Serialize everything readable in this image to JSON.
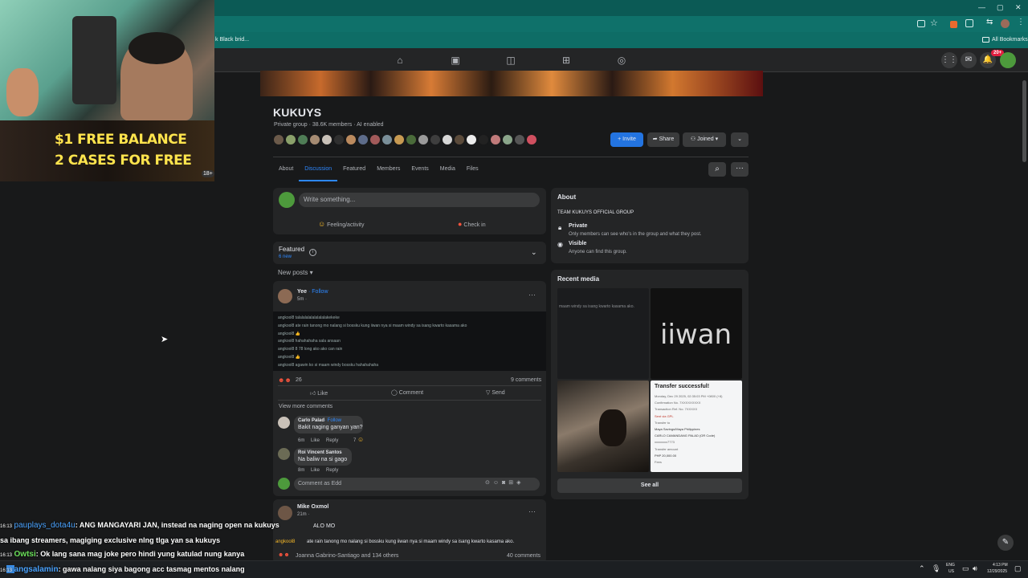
{
  "browser": {
    "bookmark_fragment": "k Black brid...",
    "all_bookmarks": "All Bookmarks",
    "window_controls": [
      "—",
      "▢",
      "✕"
    ]
  },
  "fbnav": {
    "notification_badge": "20+"
  },
  "group": {
    "name": "KUKUYS",
    "meta": "Private group · 38.6K members · AI enabled",
    "invite_label": "Invite",
    "share_label": "Share",
    "joined_label": "Joined",
    "tabs": [
      "About",
      "Discussion",
      "Featured",
      "Members",
      "Events",
      "Media",
      "Files"
    ],
    "active_tab": "Discussion"
  },
  "composer": {
    "placeholder": "Write something...",
    "feeling_label": "Feeling/activity",
    "checkin_label": "Check in"
  },
  "featured": {
    "title": "Featured",
    "subtitle": "6 new"
  },
  "feed": {
    "sort_label": "New posts",
    "post1": {
      "author": "Yee",
      "follow": "· Follow",
      "time": "5m ·",
      "reaction_count": "26",
      "comment_count": "9 comments",
      "like": "Like",
      "comment": "Comment",
      "send": "Send",
      "view_more": "View more comments",
      "embedded_lines": [
        "angkool8  talalalalalalalalalakekeke",
        "angkool8  ate rain tanong mo nalang si bossku kung iiwan nya si maam windy sa isang kwarto kasama ako",
        "angkool8  👍",
        "angkool8  hahahahaha sala ansaan",
        "angkool8  8 78 long ako ako can rain",
        "angkool8  👍",
        "angkool8  agawin ko si maam windy bossku hahahahaha"
      ],
      "comments": [
        {
          "author": "Carlo Palad",
          "follow": "· Follow",
          "text": "Bakit naging ganyan yan?",
          "time": "6m",
          "like": "Like",
          "reply": "Reply",
          "reactions": "7"
        },
        {
          "author": "Roi Vincent Santos",
          "follow": "",
          "text": "Na baliw na si gago",
          "time": "8m",
          "like": "Like",
          "reply": "Reply",
          "reactions": ""
        }
      ],
      "comment_placeholder": "Comment as Edd"
    },
    "post2": {
      "author": "Mike Oxmol",
      "time": "21m ·",
      "text_fragment": "ALO MO",
      "quote_user": "angkool8",
      "quote_text": "ate rain tanong mo nalang si bossku kung iiwan nya si maam windy sa isang kwarto kasama ako.",
      "reactors": "Joanna Gabrino-Santiago and 134 others",
      "comment_count": "40 comments"
    }
  },
  "about": {
    "title": "About",
    "description": "TEAM KUKUYS OFFICIAL GROUP",
    "private_title": "Private",
    "private_desc": "Only members can see who's in the group and what they post.",
    "visible_title": "Visible",
    "visible_desc": "Anyone can find this group."
  },
  "recent_media": {
    "title": "Recent media",
    "tile1_text": "maam windy sa isang kwarto kasama ako.",
    "tile2_text": "iiwan",
    "tile4_title": "Transfer successful!",
    "tile4_lines": [
      "Monday, Dec 29 2025, 02:35:03 PM +0800 (+8)",
      "Confirmation No. 7XXXXXXXXX",
      "Transaction Ref. No. 7XXXXX",
      "Sent via GPL",
      "Transfer to",
      "Maya Savings/Maya Philippines",
      "CARLO CAMANDANG PALAD (OR Code)",
      "xxxxxxxx7773",
      "Transfer amount",
      "PHP 20,000.00",
      "Fees"
    ],
    "see_all": "See all"
  },
  "stream": {
    "promo_line1": "$1 FREE BALANCE",
    "promo_line2": "2 CASES FOR FREE",
    "promo_age": "18+",
    "chat": [
      {
        "time": "16:13",
        "user": "pauplays_dota4u",
        "user_color": "#4aa3ff",
        "msg": ": ANG MANGAYARI JAN, instead na naging open na kukuys"
      },
      {
        "time": "",
        "user": "",
        "user_color": "#ffffff",
        "msg": "sa ibang streamers, magiging exclusive nlng tlga yan sa kukuys"
      },
      {
        "time": "16:13",
        "user": "Owtsi",
        "user_color": "#6be05a",
        "msg": ": Ok lang sana mag joke pero hindi yung katulad nung kanya"
      },
      {
        "time": "16:13",
        "user": "angsalamin",
        "user_color": "#4aa3ff",
        "msg": ": gawa nalang siya bagong acc tasmag mentos nalang"
      }
    ]
  },
  "taskbar": {
    "lang_top": "ENG",
    "lang_bottom": "US",
    "time": "4:13 PM",
    "date": "12/29/2025"
  },
  "colors": {
    "accent": "#2d88ff",
    "chrome": "#0f716a",
    "card": "#242526",
    "bg": "#18191a"
  }
}
